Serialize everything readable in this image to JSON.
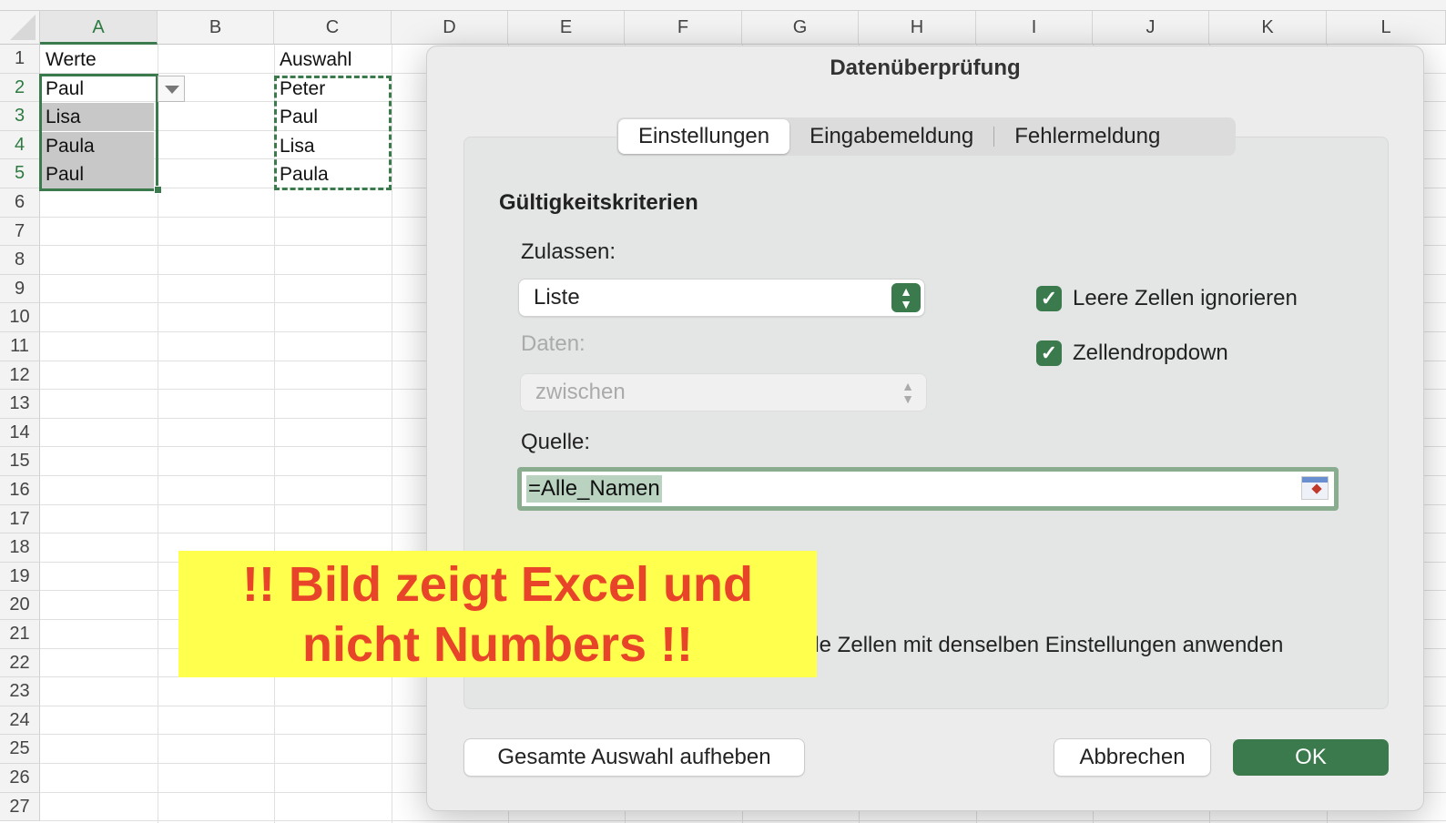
{
  "spreadsheet": {
    "columns": [
      "A",
      "B",
      "C",
      "D",
      "E",
      "F",
      "G",
      "H",
      "I",
      "J",
      "K",
      "L"
    ],
    "rows": [
      "1",
      "2",
      "3",
      "4",
      "5",
      "6",
      "7",
      "8",
      "9",
      "10",
      "11",
      "12",
      "13",
      "14",
      "15",
      "16",
      "17",
      "18",
      "19",
      "20",
      "21",
      "22",
      "23",
      "24",
      "25",
      "26",
      "27"
    ],
    "cells": {
      "A1": "Werte",
      "A2": "Paul",
      "A3": "Lisa",
      "A4": "Paula",
      "A5": "Paul",
      "C1": "Auswahl",
      "C2": "Peter",
      "C3": "Paul",
      "C4": "Lisa",
      "C5": "Paula"
    }
  },
  "dialog": {
    "title": "Datenüberprüfung",
    "tabs": [
      "Einstellungen",
      "Eingabemeldung",
      "Fehlermeldung"
    ],
    "section_title": "Gültigkeitskriterien",
    "allow_label": "Zulassen:",
    "allow_value": "Liste",
    "data_label": "Daten:",
    "data_value": "zwischen",
    "ignore_blank_label": "Leere Zellen ignorieren",
    "ignore_blank_checked": true,
    "in_cell_dropdown_label": "Zellendropdown",
    "in_cell_dropdown_checked": true,
    "source_label": "Quelle:",
    "source_value": "=Alle_Namen",
    "apply_all_label_visible": "lle Zellen mit denselben Einstellungen anwenden",
    "clear_all_button": "Gesamte Auswahl aufheben",
    "cancel_button": "Abbrechen",
    "ok_button": "OK"
  },
  "banner": {
    "line1": "!! Bild zeigt Excel und",
    "line2": "nicht Numbers !!"
  },
  "colors": {
    "accent": "#3a7a4c",
    "banner_bg": "#ffff4d",
    "banner_text": "#e8442a"
  }
}
